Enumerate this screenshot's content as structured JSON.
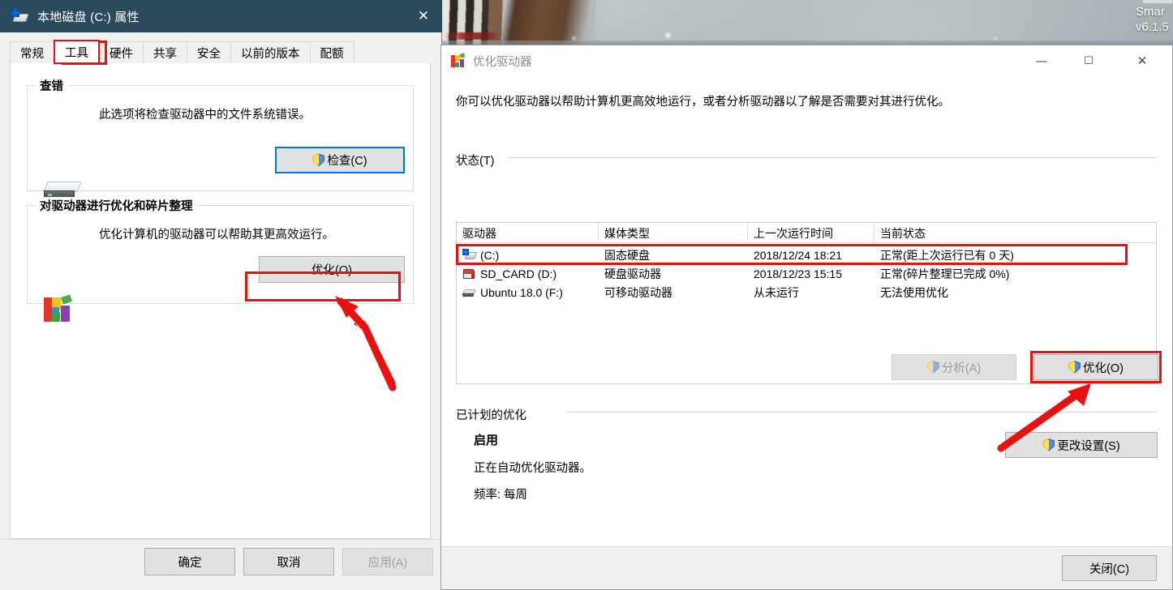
{
  "desktop": {
    "watermark_line1": "Smar",
    "watermark_line2": "v6.1.5"
  },
  "properties_dialog": {
    "title": "本地磁盘 (C:) 属性",
    "title_icon": "disk-drive-icon",
    "close_glyph": "✕",
    "tabs": [
      {
        "label": "常规",
        "active": false
      },
      {
        "label": "工具",
        "active": true
      },
      {
        "label": "硬件",
        "active": false
      },
      {
        "label": "共享",
        "active": false
      },
      {
        "label": "安全",
        "active": false
      },
      {
        "label": "以前的版本",
        "active": false
      },
      {
        "label": "配额",
        "active": false
      }
    ],
    "error_checking": {
      "legend": "查错",
      "description": "此选项将检查驱动器中的文件系统错误。",
      "icon": "hard-disk-icon",
      "button_label": "检查(C)",
      "button_icon": "uac-shield-icon"
    },
    "optimize_group": {
      "legend": "对驱动器进行优化和碎片整理",
      "description": "优化计算机的驱动器可以帮助其更高效运行。",
      "icon": "defragment-icon",
      "button_label": "优化(O)"
    },
    "footer": {
      "ok": "确定",
      "cancel": "取消",
      "apply": "应用(A)"
    }
  },
  "optimize_window": {
    "title": "优化驱动器",
    "title_icon": "defragment-icon",
    "minimize_glyph": "—",
    "maximize_glyph": "☐",
    "close_glyph": "✕",
    "intro": "你可以优化驱动器以帮助计算机更高效地运行，或者分析驱动器以了解是否需要对其进行优化。",
    "status_section": {
      "heading": "状态(T)",
      "columns": [
        "驱动器",
        "媒体类型",
        "上一次运行时间",
        "当前状态"
      ],
      "rows": [
        {
          "icon": "system-drive-icon",
          "drive": "(C:)",
          "media_type": "固态硬盘",
          "last_run": "2018/12/24 18:21",
          "current_status": "正常(距上次运行已有 0 天)",
          "highlighted": true
        },
        {
          "icon": "sd-card-icon",
          "drive": "SD_CARD (D:)",
          "media_type": "硬盘驱动器",
          "last_run": "2018/12/23 15:15",
          "current_status": "正常(碎片整理已完成 0%)",
          "highlighted": false
        },
        {
          "icon": "removable-drive-icon",
          "drive": "Ubuntu 18.0 (F:)",
          "media_type": "可移动驱动器",
          "last_run": "从未运行",
          "current_status": "无法使用优化",
          "highlighted": false
        }
      ],
      "analyze_button": "分析(A)",
      "analyze_disabled": true,
      "optimize_button": "优化(O)"
    },
    "scheduled_section": {
      "heading": "已计划的优化",
      "state": "启用",
      "detail": "正在自动优化驱动器。",
      "frequency": "频率: 每周",
      "change_settings_button": "更改设置(S)"
    },
    "footer": {
      "close": "关闭(C)"
    }
  },
  "annotations": {
    "accent_red": "#e8110f",
    "focus_blue": "#0078d7",
    "titlebar_blue": "#2b4a5c"
  }
}
